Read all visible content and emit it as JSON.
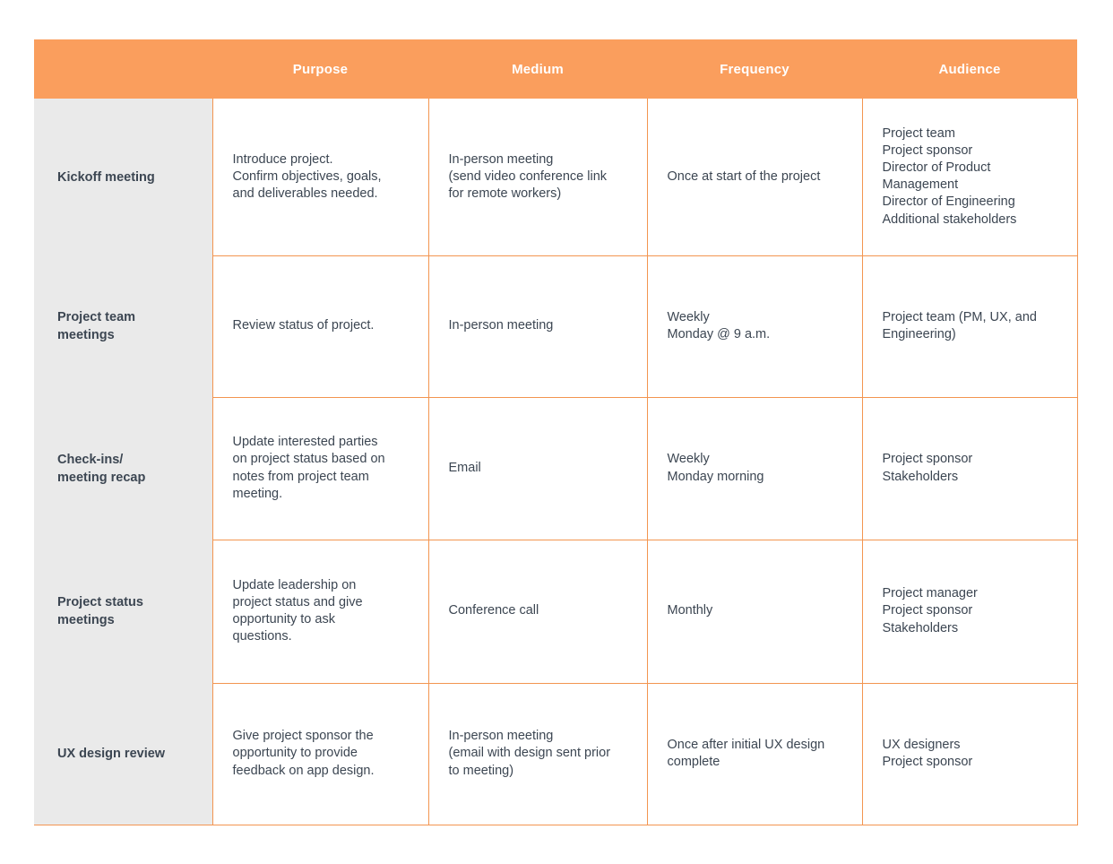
{
  "table": {
    "accent_color": "#fa9e5d",
    "border_color": "#f39550",
    "row_label_bg": "#eaeaea",
    "text_color": "#3c4652",
    "header": {
      "corner": "",
      "columns": [
        "Purpose",
        "Medium",
        "Frequency",
        "Audience"
      ]
    },
    "rows": [
      {
        "label": "Kickoff meeting",
        "purpose": "Introduce project.\nConfirm objectives, goals,\nand deliverables needed.",
        "medium": "In-person meeting\n(send video conference link\nfor remote workers)",
        "frequency": "Once at start of the project",
        "audience": "Project team\nProject sponsor\nDirector of Product\nManagement\nDirector of Engineering\nAdditional stakeholders"
      },
      {
        "label": "Project team\nmeetings",
        "purpose": "Review status of project.",
        "medium": "In-person meeting",
        "frequency": "Weekly\nMonday @ 9 a.m.",
        "audience": "Project team (PM, UX, and\nEngineering)"
      },
      {
        "label": "Check-ins/\nmeeting recap",
        "purpose": "Update interested parties\non project status based on\nnotes from project team\nmeeting.",
        "medium": "Email",
        "frequency": "Weekly\nMonday morning",
        "audience": "Project sponsor\nStakeholders"
      },
      {
        "label": "Project status\nmeetings",
        "purpose": "Update leadership on\nproject status and give\nopportunity to ask\nquestions.",
        "medium": "Conference call",
        "frequency": "Monthly",
        "audience": "Project manager\nProject sponsor\nStakeholders"
      },
      {
        "label": "UX design review",
        "purpose": "Give project sponsor the\nopportunity to provide\nfeedback on app design.",
        "medium": "In-person meeting\n(email with design sent prior\nto meeting)",
        "frequency": "Once after initial UX design\ncomplete",
        "audience": "UX designers\nProject sponsor"
      }
    ]
  }
}
